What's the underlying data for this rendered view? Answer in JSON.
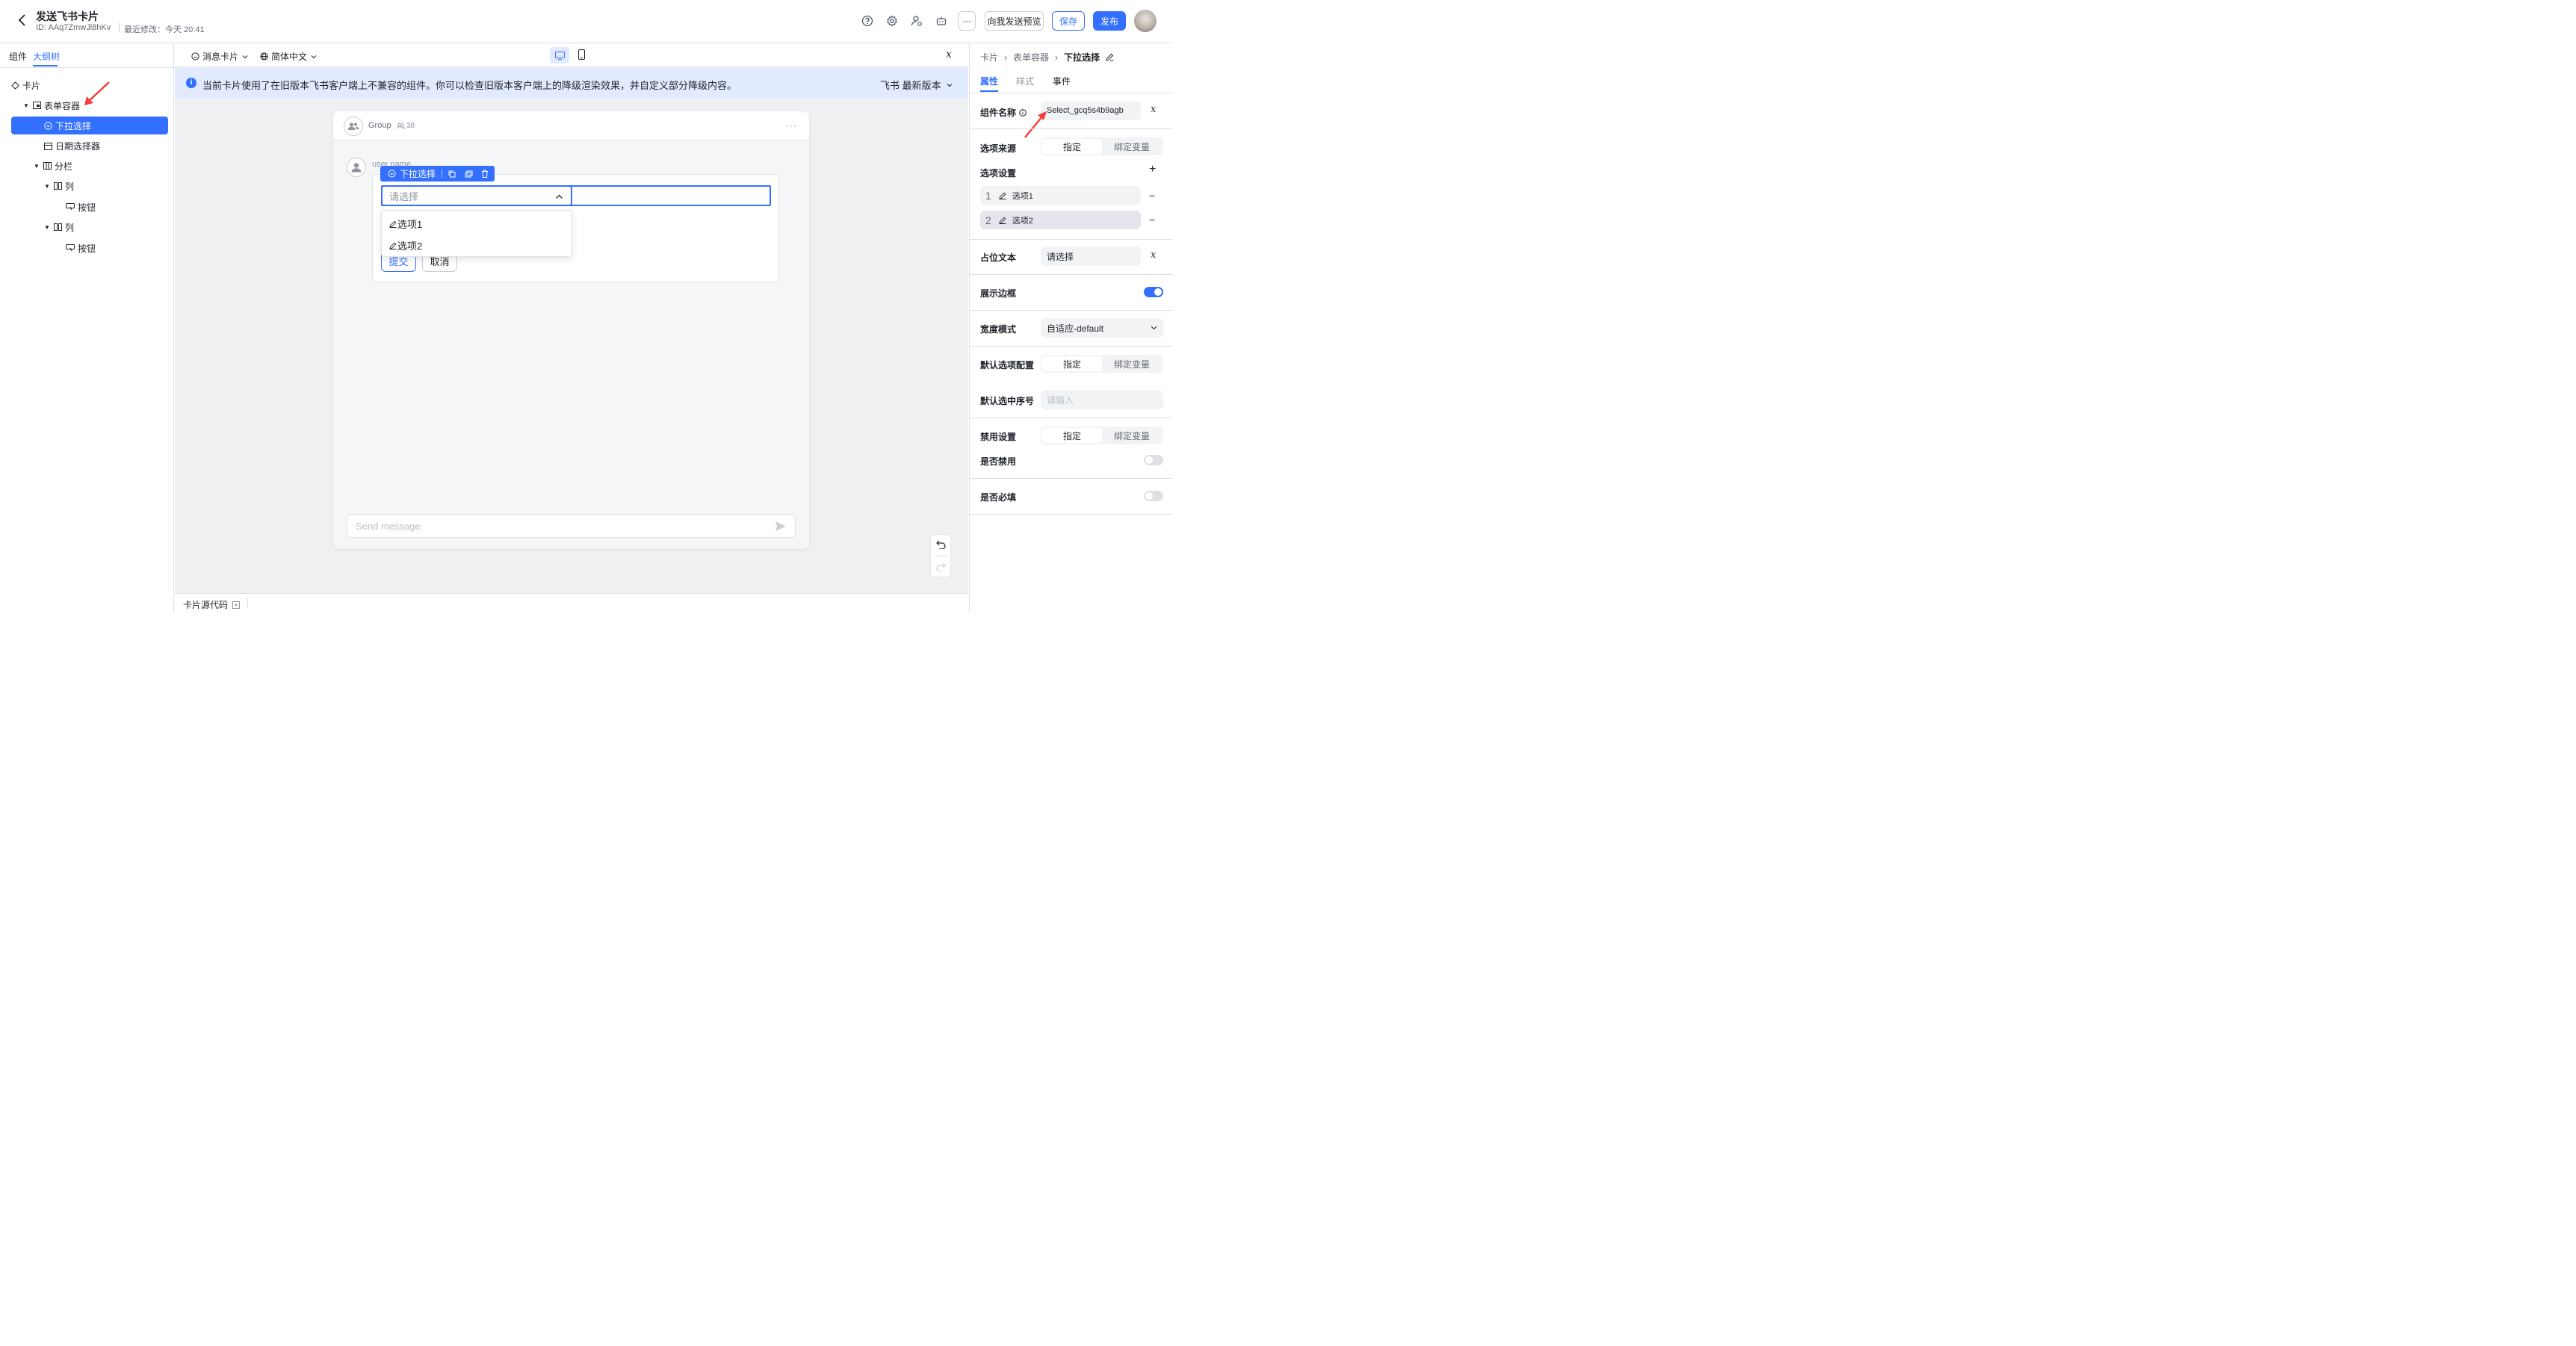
{
  "header": {
    "title": "发送飞书卡片",
    "id_text": "ID: AAq7ZmwJl8hKv",
    "modified": "最近修改：今天 20:41",
    "preview_btn": "向我发送预览",
    "save_btn": "保存",
    "publish_btn": "发布",
    "more": "···"
  },
  "left": {
    "tabs": [
      "组件",
      "大纲树"
    ],
    "tree": [
      {
        "label": "卡片"
      },
      {
        "label": "表单容器"
      },
      {
        "label": "下拉选择"
      },
      {
        "label": "日期选择器"
      },
      {
        "label": "分栏"
      },
      {
        "label": "列"
      },
      {
        "label": "按钮"
      },
      {
        "label": "列"
      },
      {
        "label": "按钮"
      }
    ]
  },
  "toolbar": {
    "msg_card": "消息卡片",
    "lang": "简体中文",
    "fx": "𝑥"
  },
  "notice": {
    "text": "当前卡片使用了在旧版本飞书客户端上不兼容的组件。你可以检查旧版本客户端上的降级渲染效果，并自定义部分降级内容。",
    "version": "飞书 最新版本"
  },
  "preview": {
    "group_name": "Group",
    "member_count": "38",
    "user_name": "user name",
    "tag_label": "下拉选择",
    "select_placeholder": "请选择",
    "options": [
      "选项1",
      "选项2"
    ],
    "submit": "提交",
    "cancel": "取消",
    "send_placeholder": "Send message"
  },
  "footer": {
    "source": "卡片源代码"
  },
  "right": {
    "breadcrumb": [
      "卡片",
      "表单容器",
      "下拉选择"
    ],
    "tabs": [
      "属性",
      "样式",
      "事件"
    ],
    "name_label": "组件名称",
    "name_value": "Select_gcq5s4b9agb",
    "source_label": "选项来源",
    "seg_fixed": "指定",
    "seg_bind": "绑定变量",
    "options_label": "选项设置",
    "options": [
      {
        "num": "1",
        "label": "选项1"
      },
      {
        "num": "2",
        "label": "选项2"
      }
    ],
    "placeholder_label": "占位文本",
    "placeholder_value": "请选择",
    "border_label": "展示边框",
    "width_label": "宽度模式",
    "width_value": "自适应-default",
    "default_label": "默认选项配置",
    "default_index_label": "默认选中序号",
    "default_index_placeholder": "请输入",
    "disable_label": "禁用设置",
    "is_disabled": "是否禁用",
    "is_required": "是否必填"
  },
  "colors": {
    "accent": "#3370ff",
    "notice_bg": "#e1eaff",
    "canvas_bg": "#eff0f1"
  }
}
